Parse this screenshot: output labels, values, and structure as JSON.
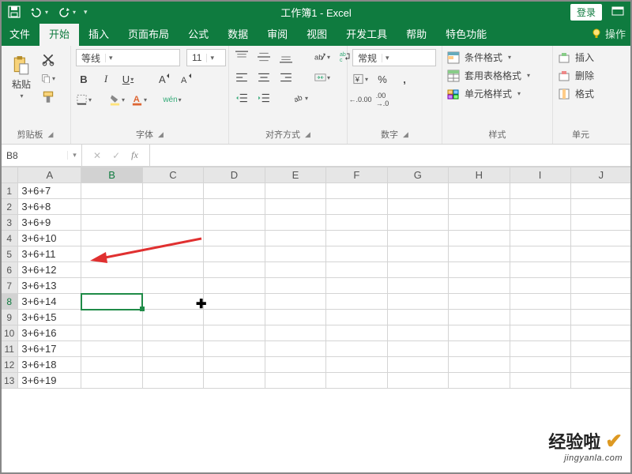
{
  "titlebar": {
    "title": "工作簿1 - Excel",
    "login": "登录"
  },
  "tabs": {
    "file": "文件",
    "home": "开始",
    "insert": "插入",
    "layout": "页面布局",
    "formulas": "公式",
    "data": "数据",
    "review": "审阅",
    "view": "视图",
    "dev": "开发工具",
    "help": "帮助",
    "special": "特色功能",
    "tell": "操作"
  },
  "ribbon": {
    "clipboard": {
      "label": "剪贴板",
      "paste": "粘贴"
    },
    "font": {
      "label": "字体",
      "name": "等线",
      "size": "11",
      "bold": "B",
      "italic": "I",
      "underline": "U",
      "pinyin": "wén"
    },
    "align": {
      "label": "对齐方式"
    },
    "number": {
      "label": "数字",
      "format": "常规",
      "percent": "%",
      "comma": ",",
      "inc": ".00",
      "dec": ".00"
    },
    "styles": {
      "label": "样式",
      "cond": "条件格式",
      "table": "套用表格格式",
      "cell": "单元格样式"
    },
    "cells": {
      "label": "单元",
      "insert": "插入",
      "delete": "删除",
      "format": "格式"
    }
  },
  "fxbar": {
    "namebox": "B8",
    "fx": "fx",
    "formula": ""
  },
  "grid": {
    "cols": [
      "A",
      "B",
      "C",
      "D",
      "E",
      "F",
      "G",
      "H",
      "I",
      "J"
    ],
    "rows": [
      "1",
      "2",
      "3",
      "4",
      "5",
      "6",
      "7",
      "8",
      "9",
      "10",
      "11",
      "12",
      "13"
    ],
    "colA": [
      "3+6+7",
      "3+6+8",
      "3+6+9",
      "3+6+10",
      "3+6+11",
      "3+6+12",
      "3+6+13",
      "3+6+14",
      "3+6+15",
      "3+6+16",
      "3+6+17",
      "3+6+18",
      "3+6+19"
    ],
    "selected": {
      "row": 8,
      "col": "B"
    }
  },
  "watermark": {
    "big": "经验啦",
    "check": "✔",
    "small": "jingyanla.com"
  },
  "chart_data": {
    "type": "table",
    "columns": [
      "A"
    ],
    "rows": [
      {
        "A": "3+6+7"
      },
      {
        "A": "3+6+8"
      },
      {
        "A": "3+6+9"
      },
      {
        "A": "3+6+10"
      },
      {
        "A": "3+6+11"
      },
      {
        "A": "3+6+12"
      },
      {
        "A": "3+6+13"
      },
      {
        "A": "3+6+14"
      },
      {
        "A": "3+6+15"
      },
      {
        "A": "3+6+16"
      },
      {
        "A": "3+6+17"
      },
      {
        "A": "3+6+18"
      },
      {
        "A": "3+6+19"
      }
    ],
    "selected_cell": "B8"
  }
}
